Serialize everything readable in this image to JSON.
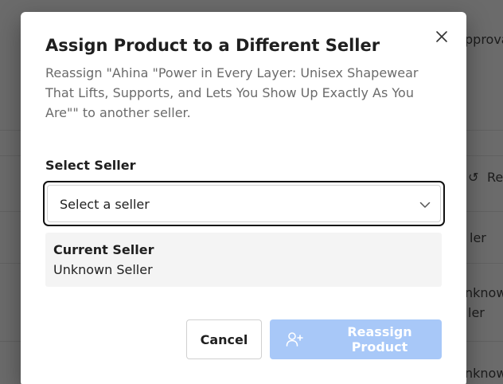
{
  "background": {
    "texts": [
      "pproval",
      "Re",
      "ler",
      "nknow",
      "ler",
      "nknow"
    ]
  },
  "dialog": {
    "title": "Assign Product to a Different Seller",
    "description": "Reassign \"Ahina \"Power in Every Layer: Unisex Shapewear That Lifts, Supports, and Lets You Show Up Exactly As You Are\"\" to another seller.",
    "close_icon": "close-icon",
    "select_label": "Select Seller",
    "select_placeholder": "Select a seller",
    "chevron_icon": "chevron-down-icon",
    "current_seller_label": "Current Seller",
    "current_seller_value": "Unknown Seller",
    "cancel_label": "Cancel",
    "reassign_label": "Reassign Product",
    "reassign_icon": "user-plus-icon"
  },
  "colors": {
    "primary_disabled": "#a8c8f8",
    "overlay": "rgba(0,0,0,0.58)",
    "select_border": "#111111"
  }
}
